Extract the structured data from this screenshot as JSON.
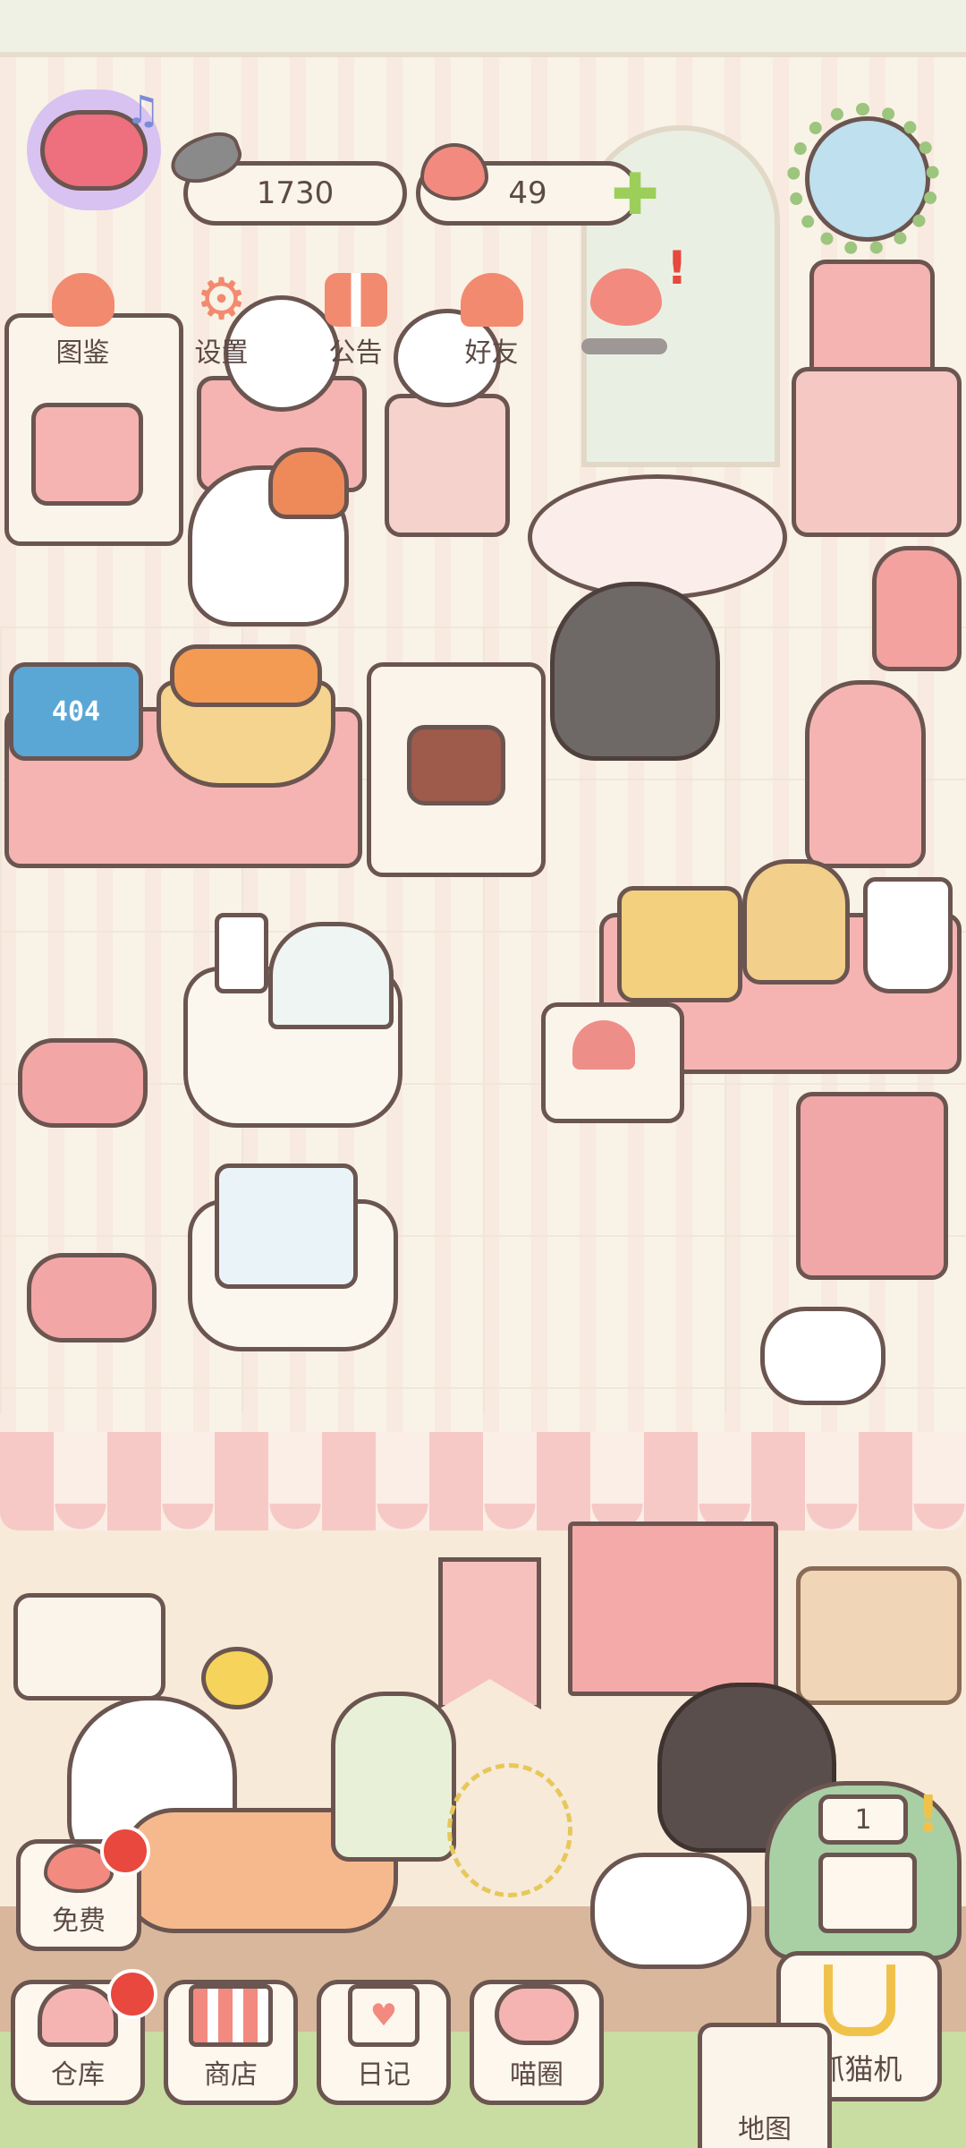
{
  "hud": {
    "fish_currency": "1730",
    "heart_currency": "49",
    "menu": [
      {
        "label": "图鉴",
        "icon": "catalog-cat-icon"
      },
      {
        "label": "设置",
        "icon": "gear-icon"
      },
      {
        "label": "公告",
        "icon": "gift-icon"
      },
      {
        "label": "好友",
        "icon": "friends-icon"
      }
    ]
  },
  "scene": {
    "screen_text": "404",
    "slot_machine_count": "1"
  },
  "bottom_bar": {
    "free_label": "免费",
    "items": [
      {
        "label": "仓库",
        "icon": "storage-icon"
      },
      {
        "label": "商店",
        "icon": "shop-icon"
      },
      {
        "label": "日记",
        "icon": "diary-icon"
      },
      {
        "label": "喵圈",
        "icon": "cat-planet-icon"
      }
    ],
    "claw_label": "抓猫机",
    "map_label": "地图"
  },
  "colors": {
    "outline": "#6b5550",
    "pink": "#f5b4b1",
    "cream": "#fbf4ea",
    "accent_orange": "#f28a6f",
    "notice_red": "#e8483d",
    "plus_green": "#9ccf5a"
  }
}
